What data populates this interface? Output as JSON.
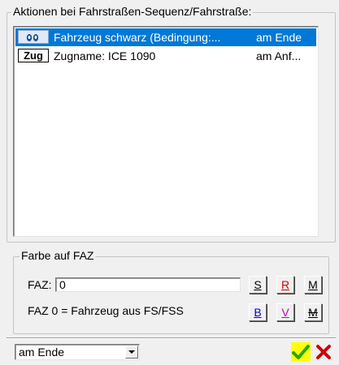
{
  "actions_group": {
    "title": "Aktionen bei Fahrstraßen-Sequenz/Fahrstraße:",
    "items": [
      {
        "icon": "vehicle-eyes-icon",
        "text": "Fahrzeug schwarz (Bedingung:...",
        "when": "am Ende",
        "selected": true
      },
      {
        "icon": "zug-icon",
        "icon_text": "Zug",
        "text": "Zugname: ICE 1090",
        "when": "am Anf...",
        "selected": false
      }
    ]
  },
  "color_group": {
    "title": "Farbe auf FAZ",
    "faz_label": "FAZ:",
    "faz_value": "0",
    "hint": "FAZ 0 = Fahrzeug aus FS/FSS",
    "buttons_row1": [
      {
        "label": "S",
        "color": "#000000"
      },
      {
        "label": "R",
        "color": "#d40000"
      },
      {
        "label": "M",
        "color": "#000000"
      }
    ],
    "buttons_row2": [
      {
        "label": "B",
        "color": "#0000cc"
      },
      {
        "label": "V",
        "color": "#c000c0"
      },
      {
        "label": "M",
        "color": "#000000",
        "strike": true
      }
    ]
  },
  "footer": {
    "timing_select": "am Ende",
    "ok_color": "#22aa00",
    "cancel_color": "#cc0000",
    "highlight_color": "#ffff00"
  }
}
